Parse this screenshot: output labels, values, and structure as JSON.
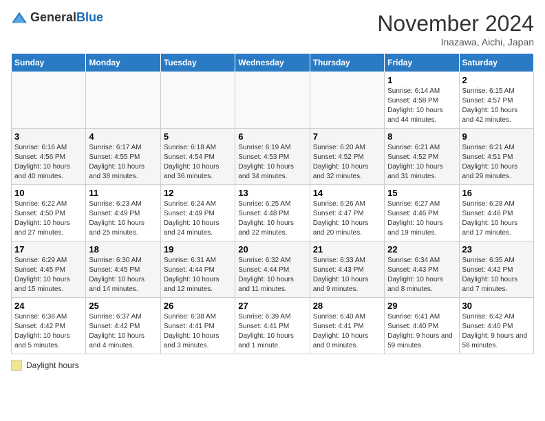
{
  "header": {
    "logo_general": "General",
    "logo_blue": "Blue",
    "month_title": "November 2024",
    "subtitle": "Inazawa, Aichi, Japan"
  },
  "days_of_week": [
    "Sunday",
    "Monday",
    "Tuesday",
    "Wednesday",
    "Thursday",
    "Friday",
    "Saturday"
  ],
  "weeks": [
    [
      {
        "day": "",
        "info": ""
      },
      {
        "day": "",
        "info": ""
      },
      {
        "day": "",
        "info": ""
      },
      {
        "day": "",
        "info": ""
      },
      {
        "day": "",
        "info": ""
      },
      {
        "day": "1",
        "info": "Sunrise: 6:14 AM\nSunset: 4:58 PM\nDaylight: 10 hours and 44 minutes."
      },
      {
        "day": "2",
        "info": "Sunrise: 6:15 AM\nSunset: 4:57 PM\nDaylight: 10 hours and 42 minutes."
      }
    ],
    [
      {
        "day": "3",
        "info": "Sunrise: 6:16 AM\nSunset: 4:56 PM\nDaylight: 10 hours and 40 minutes."
      },
      {
        "day": "4",
        "info": "Sunrise: 6:17 AM\nSunset: 4:55 PM\nDaylight: 10 hours and 38 minutes."
      },
      {
        "day": "5",
        "info": "Sunrise: 6:18 AM\nSunset: 4:54 PM\nDaylight: 10 hours and 36 minutes."
      },
      {
        "day": "6",
        "info": "Sunrise: 6:19 AM\nSunset: 4:53 PM\nDaylight: 10 hours and 34 minutes."
      },
      {
        "day": "7",
        "info": "Sunrise: 6:20 AM\nSunset: 4:52 PM\nDaylight: 10 hours and 32 minutes."
      },
      {
        "day": "8",
        "info": "Sunrise: 6:21 AM\nSunset: 4:52 PM\nDaylight: 10 hours and 31 minutes."
      },
      {
        "day": "9",
        "info": "Sunrise: 6:21 AM\nSunset: 4:51 PM\nDaylight: 10 hours and 29 minutes."
      }
    ],
    [
      {
        "day": "10",
        "info": "Sunrise: 6:22 AM\nSunset: 4:50 PM\nDaylight: 10 hours and 27 minutes."
      },
      {
        "day": "11",
        "info": "Sunrise: 6:23 AM\nSunset: 4:49 PM\nDaylight: 10 hours and 25 minutes."
      },
      {
        "day": "12",
        "info": "Sunrise: 6:24 AM\nSunset: 4:49 PM\nDaylight: 10 hours and 24 minutes."
      },
      {
        "day": "13",
        "info": "Sunrise: 6:25 AM\nSunset: 4:48 PM\nDaylight: 10 hours and 22 minutes."
      },
      {
        "day": "14",
        "info": "Sunrise: 6:26 AM\nSunset: 4:47 PM\nDaylight: 10 hours and 20 minutes."
      },
      {
        "day": "15",
        "info": "Sunrise: 6:27 AM\nSunset: 4:46 PM\nDaylight: 10 hours and 19 minutes."
      },
      {
        "day": "16",
        "info": "Sunrise: 6:28 AM\nSunset: 4:46 PM\nDaylight: 10 hours and 17 minutes."
      }
    ],
    [
      {
        "day": "17",
        "info": "Sunrise: 6:29 AM\nSunset: 4:45 PM\nDaylight: 10 hours and 15 minutes."
      },
      {
        "day": "18",
        "info": "Sunrise: 6:30 AM\nSunset: 4:45 PM\nDaylight: 10 hours and 14 minutes."
      },
      {
        "day": "19",
        "info": "Sunrise: 6:31 AM\nSunset: 4:44 PM\nDaylight: 10 hours and 12 minutes."
      },
      {
        "day": "20",
        "info": "Sunrise: 6:32 AM\nSunset: 4:44 PM\nDaylight: 10 hours and 11 minutes."
      },
      {
        "day": "21",
        "info": "Sunrise: 6:33 AM\nSunset: 4:43 PM\nDaylight: 10 hours and 9 minutes."
      },
      {
        "day": "22",
        "info": "Sunrise: 6:34 AM\nSunset: 4:43 PM\nDaylight: 10 hours and 8 minutes."
      },
      {
        "day": "23",
        "info": "Sunrise: 6:35 AM\nSunset: 4:42 PM\nDaylight: 10 hours and 7 minutes."
      }
    ],
    [
      {
        "day": "24",
        "info": "Sunrise: 6:36 AM\nSunset: 4:42 PM\nDaylight: 10 hours and 5 minutes."
      },
      {
        "day": "25",
        "info": "Sunrise: 6:37 AM\nSunset: 4:42 PM\nDaylight: 10 hours and 4 minutes."
      },
      {
        "day": "26",
        "info": "Sunrise: 6:38 AM\nSunset: 4:41 PM\nDaylight: 10 hours and 3 minutes."
      },
      {
        "day": "27",
        "info": "Sunrise: 6:39 AM\nSunset: 4:41 PM\nDaylight: 10 hours and 1 minute."
      },
      {
        "day": "28",
        "info": "Sunrise: 6:40 AM\nSunset: 4:41 PM\nDaylight: 10 hours and 0 minutes."
      },
      {
        "day": "29",
        "info": "Sunrise: 6:41 AM\nSunset: 4:40 PM\nDaylight: 9 hours and 59 minutes."
      },
      {
        "day": "30",
        "info": "Sunrise: 6:42 AM\nSunset: 4:40 PM\nDaylight: 9 hours and 58 minutes."
      }
    ]
  ],
  "legend": {
    "label": "Daylight hours"
  }
}
